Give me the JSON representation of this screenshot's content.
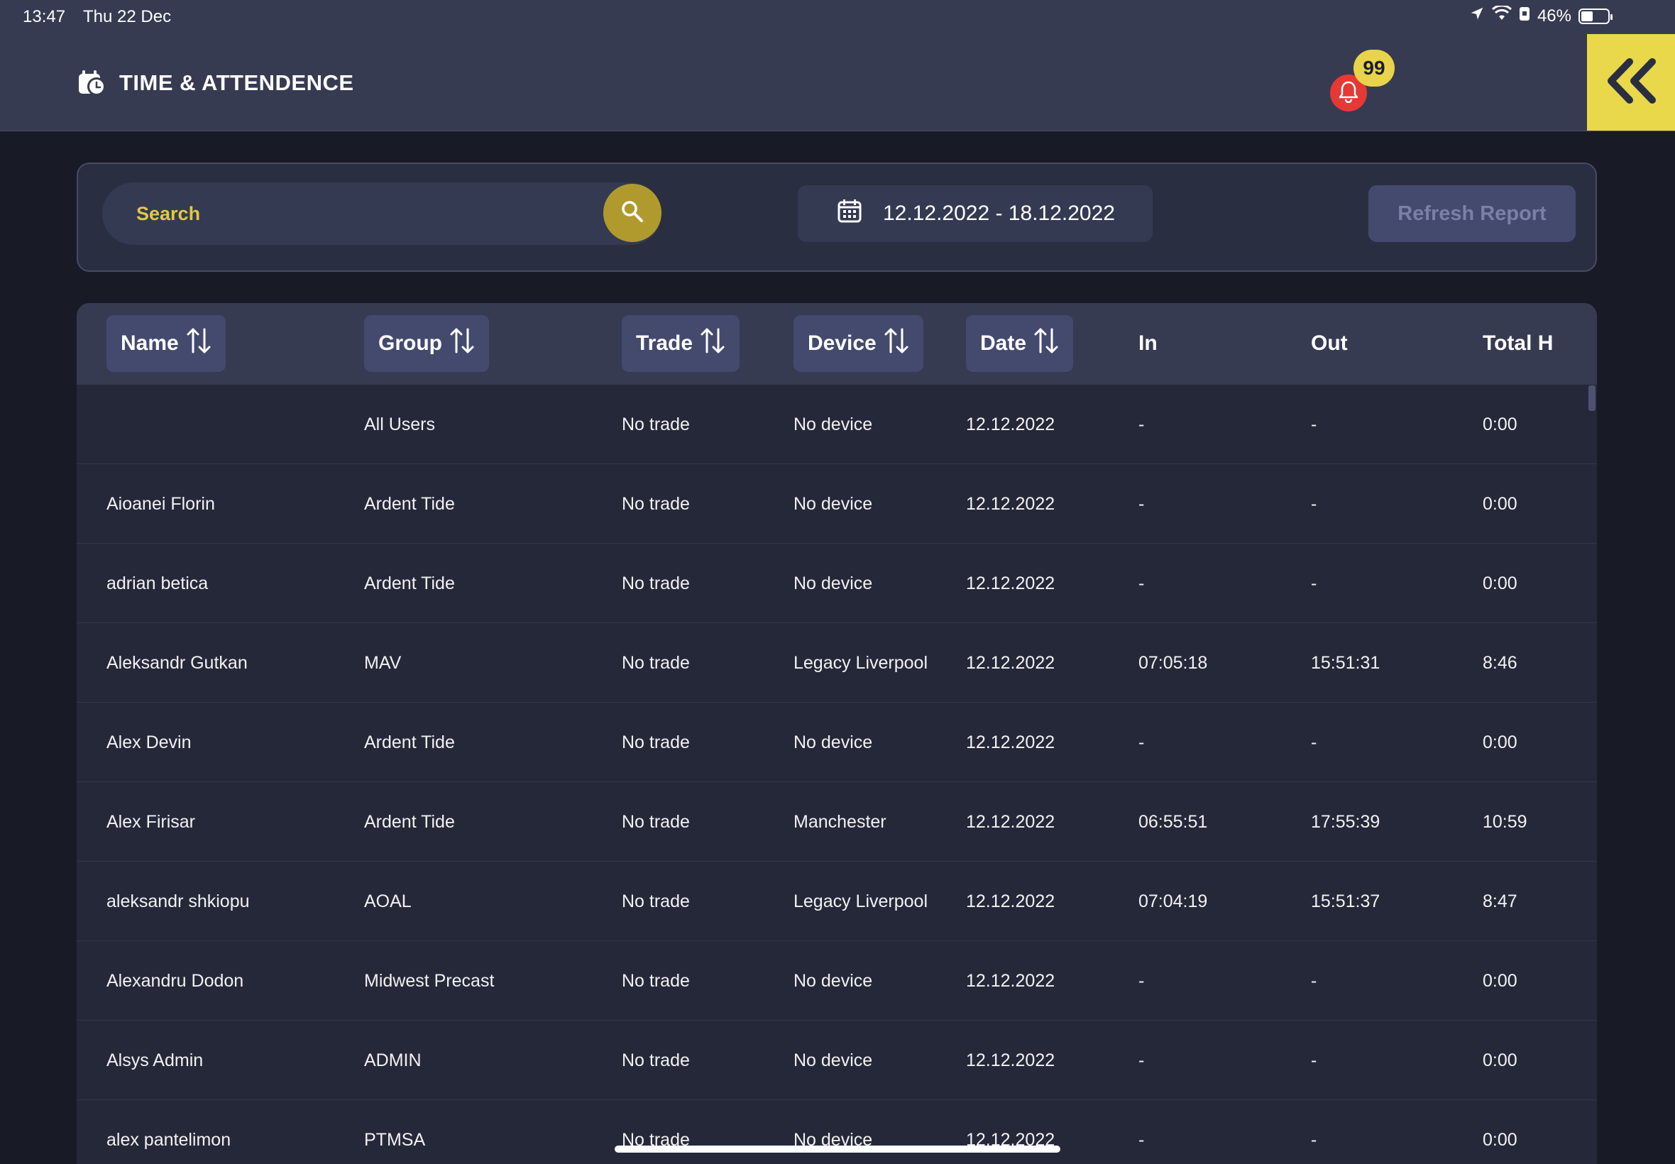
{
  "status_bar": {
    "time": "13:47",
    "date": "Thu 22 Dec",
    "battery": "46%",
    "icons": [
      "location-icon",
      "wifi-icon",
      "lock-rotation-icon",
      "battery-icon"
    ]
  },
  "header": {
    "title": "TIME & ATTENDENCE",
    "notification_count": "99",
    "icons": [
      "time-attendance-icon",
      "bell-icon",
      "collapse-icon"
    ]
  },
  "filters": {
    "search_placeholder": "Search",
    "date_range": "12.12.2022 - 18.12.2022",
    "refresh_label": "Refresh Report"
  },
  "table": {
    "columns": [
      "Name",
      "Group",
      "Trade",
      "Device",
      "Date",
      "In",
      "Out",
      "Total H"
    ],
    "rows": [
      [
        "",
        "All Users",
        "No trade",
        "No device",
        "12.12.2022",
        "-",
        "-",
        "0:00"
      ],
      [
        "Aioanei Florin",
        "Ardent Tide",
        "No trade",
        "No device",
        "12.12.2022",
        "-",
        "-",
        "0:00"
      ],
      [
        "adrian betica",
        "Ardent Tide",
        "No trade",
        "No device",
        "12.12.2022",
        "-",
        "-",
        "0:00"
      ],
      [
        "Aleksandr Gutkan",
        "MAV",
        "No trade",
        "Legacy Liverpool",
        "12.12.2022",
        "07:05:18",
        "15:51:31",
        "8:46"
      ],
      [
        "Alex Devin",
        "Ardent Tide",
        "No trade",
        "No device",
        "12.12.2022",
        "-",
        "-",
        "0:00"
      ],
      [
        "Alex Firisar",
        "Ardent Tide",
        "No trade",
        "Manchester",
        "12.12.2022",
        "06:55:51",
        "17:55:39",
        "10:59"
      ],
      [
        "aleksandr shkiopu",
        "AOAL",
        "No trade",
        "Legacy Liverpool",
        "12.12.2022",
        "07:04:19",
        "15:51:37",
        "8:47"
      ],
      [
        "Alexandru Dodon",
        "Midwest Precast",
        "No trade",
        "No device",
        "12.12.2022",
        "-",
        "-",
        "0:00"
      ],
      [
        "Alsys Admin",
        "ADMIN",
        "No trade",
        "No device",
        "12.12.2022",
        "-",
        "-",
        "0:00"
      ],
      [
        "alex pantelimon",
        "PTMSA",
        "No trade",
        "No device",
        "12.12.2022",
        "-",
        "-",
        "0:00"
      ]
    ]
  },
  "colors": {
    "accent_yellow": "#e8d84a",
    "bell_red": "#e53935",
    "header_bg": "#363b52",
    "page_bg": "#181a26"
  }
}
